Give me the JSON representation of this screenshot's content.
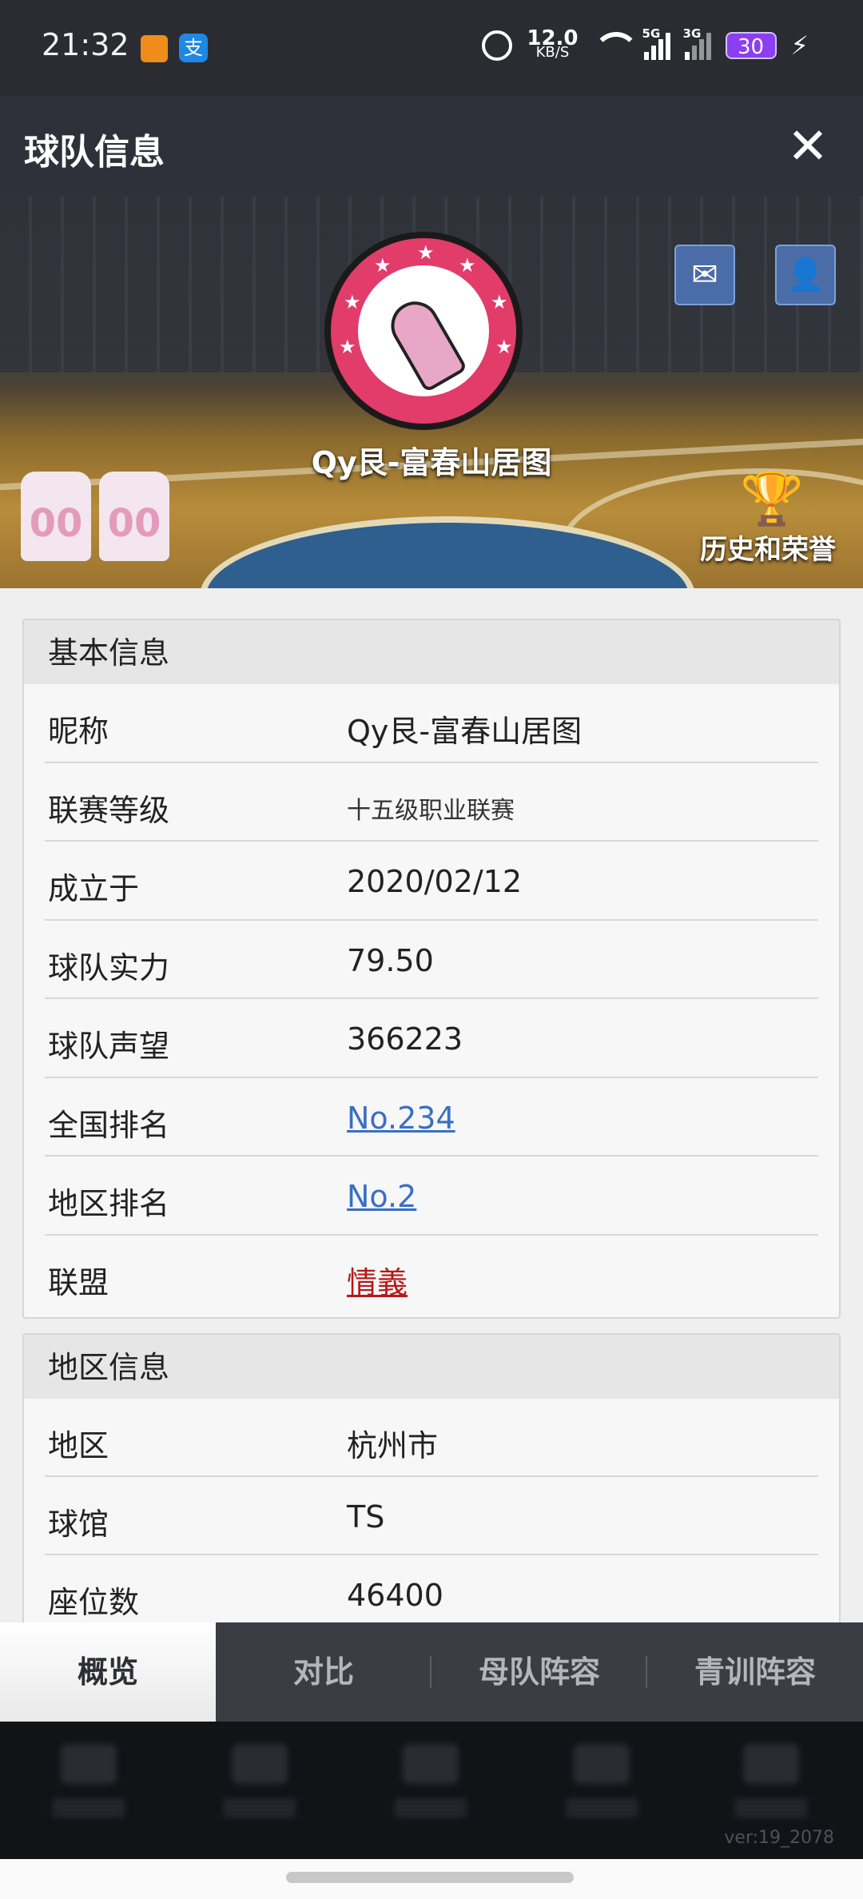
{
  "status_bar": {
    "time": "21:32",
    "net_speed": "12.0",
    "net_unit": "KB/S",
    "sig1": "5G",
    "sig2": "3G",
    "battery": "30"
  },
  "titlebar": {
    "title": "球队信息"
  },
  "hero": {
    "team_name": "Qy艮-富春山居图",
    "jersey_number": "00",
    "honor_label": "历史和荣誉"
  },
  "basic_info": {
    "title": "基本信息",
    "rows": [
      {
        "label": "昵称",
        "value": "Qy艮-富春山居图"
      },
      {
        "label": "联赛等级",
        "value": "十五级职业联赛"
      },
      {
        "label": "成立于",
        "value": "2020/02/12"
      },
      {
        "label": "球队实力",
        "value": "79.50"
      },
      {
        "label": "球队声望",
        "value": "366223"
      },
      {
        "label": "全国排名",
        "value": "No.234"
      },
      {
        "label": "地区排名",
        "value": "No.2"
      },
      {
        "label": "联盟",
        "value": "情義"
      }
    ]
  },
  "region_info": {
    "title": "地区信息",
    "rows": [
      {
        "label": "地区",
        "value": "杭州市"
      },
      {
        "label": "球馆",
        "value": "TS"
      },
      {
        "label": "座位数",
        "value": "46400"
      }
    ]
  },
  "tabs": [
    "概览",
    "对比",
    "母队阵容",
    "青训阵容"
  ],
  "version": "ver:19_2078"
}
